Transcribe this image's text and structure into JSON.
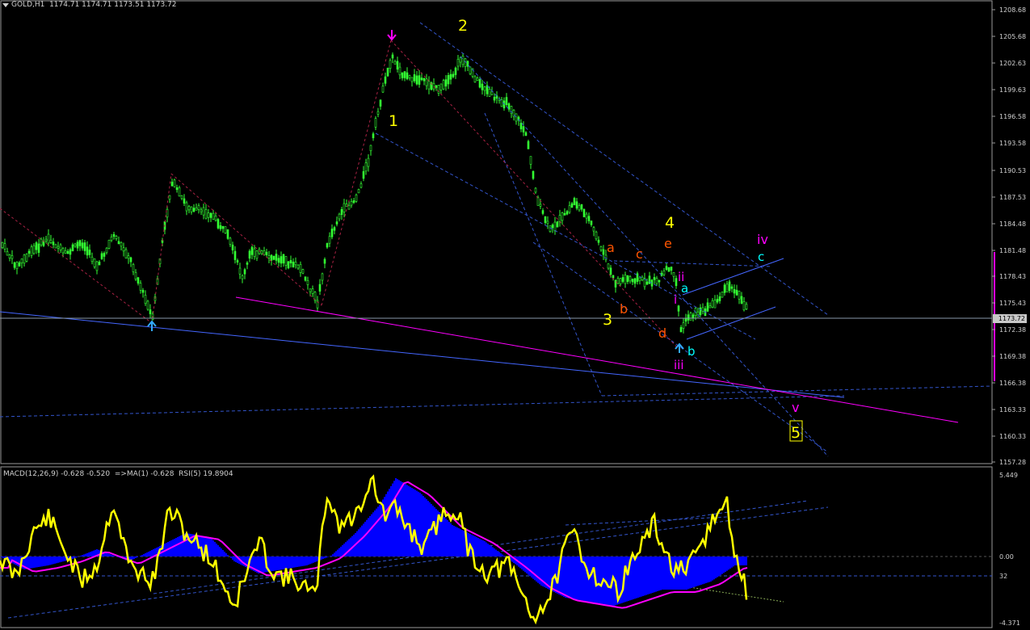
{
  "main": {
    "symbol_info": "GOLD,H1  1174.71 1174.71 1173.51 1173.72",
    "price_axis": [
      "1208.68",
      "1205.68",
      "1202.63",
      "1199.63",
      "1196.58",
      "1193.58",
      "1190.53",
      "1187.53",
      "1184.48",
      "1181.48",
      "1178.43",
      "1175.43",
      "1172.38",
      "1169.38",
      "1166.38",
      "1163.33",
      "1160.33",
      "1157.28"
    ],
    "current_price": "1173.72",
    "wave_labels": {
      "w1": "1",
      "w2": "2",
      "w3": "3",
      "w4": "4",
      "w5": "5",
      "a1": "a",
      "b1": "b",
      "c1": "c",
      "d1": "d",
      "e1": "e",
      "i": "i",
      "ii": "ii",
      "iii": "iii",
      "iv": "iv",
      "v": "v",
      "a2": "a",
      "b2": "b",
      "c2": "c"
    },
    "colors": {
      "background": "#000000",
      "candles": "#33ff33",
      "wave_primary": "#ffff00",
      "wave_abcde": "#ff5500",
      "wave_minor": "#ff00ff",
      "wave_abc": "#00ffff",
      "trend_blue": "#4466ff",
      "trend_magenta": "#ff00ff",
      "grid_dashed": "#3355cc",
      "price_tag_bg": "#c8c8c8"
    }
  },
  "indicator": {
    "title": "MACD(12,26,9) -0.628 -0.520  =>MA(1) -0.628  RSI(5) 19.8904",
    "axis": [
      "5.449",
      "0.00",
      "32",
      "-4.371"
    ],
    "colors": {
      "histogram": "#0000ff",
      "signal": "#ff00ff",
      "rsi": "#ffff00"
    }
  }
}
